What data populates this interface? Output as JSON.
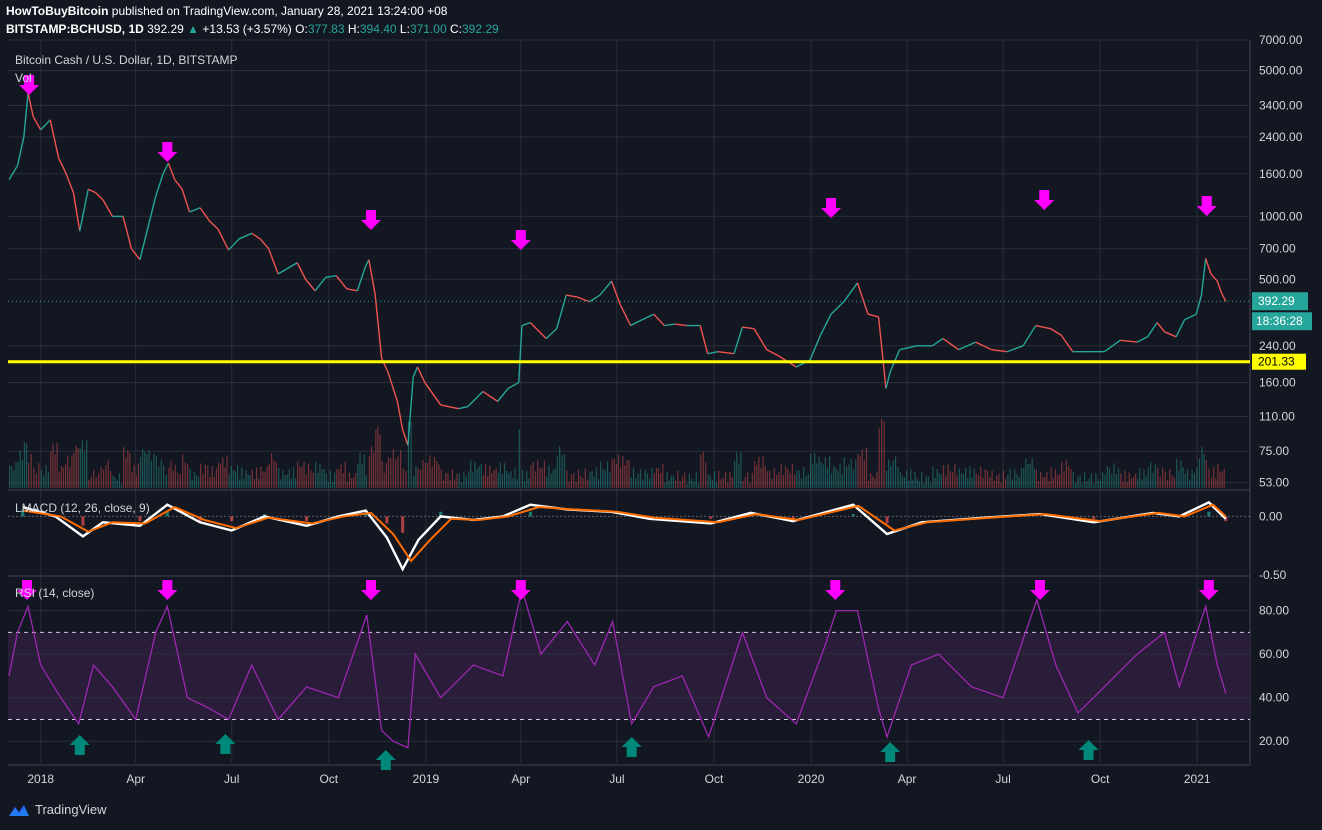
{
  "header": {
    "author": "HowToBuyBitcoin",
    "published": "published on TradingView.com, January 28, 2021 13:24:00 +08",
    "symbol": "BITSTAMP:BCHUSD, 1D",
    "price": "392.29",
    "change_arrow": "▲",
    "change": "+13.53 (+3.57%)",
    "o_label": "O:",
    "o_value": "377.83",
    "h_label": "H:",
    "h_value": "394.40",
    "l_label": "L:",
    "l_value": "371.00",
    "c_label": "C:",
    "c_value": "392.29"
  },
  "legend": {
    "main_title": "Bitcoin Cash / U.S. Dollar, 1D, BITSTAMP",
    "vol": "Vol",
    "lmacd": "LMACD (12, 26, close, 9)",
    "rsi": "RSI (14, close)"
  },
  "footer": {
    "brand": "TradingView",
    "logo_icon": "tradingview-logo-icon"
  },
  "colors": {
    "background": "#131722",
    "grid": "#2a2e39",
    "up": "#26a69a",
    "down": "#ef5350",
    "marker_sell": "#ff00ff",
    "marker_buy": "#00897b",
    "support": "#ffff00",
    "macd": "#ffffff",
    "signal": "#ff6d00",
    "rsi": "#9c27b0",
    "rsi_band": "#2a1d3a"
  },
  "chart_data": [
    {
      "type": "line",
      "name": "price",
      "yscale": "log",
      "ylim": [
        50,
        7000
      ],
      "y_ticks": [
        "7000.00",
        "5000.00",
        "3400.00",
        "2400.00",
        "1600.00",
        "1000.00",
        "700.00",
        "500.00",
        "240.00",
        "160.00",
        "110.00",
        "75.00",
        "53.00"
      ],
      "x_ticks": [
        "2018",
        "Apr",
        "Jul",
        "Oct",
        "2019",
        "Apr",
        "Jul",
        "Oct",
        "2020",
        "Apr",
        "Jul",
        "Oct",
        "2021"
      ],
      "x_range": [
        "2017-12-01",
        "2021-02-20"
      ],
      "points": [
        [
          "2017-12-02",
          1500
        ],
        [
          "2017-12-10",
          1750
        ],
        [
          "2017-12-16",
          2400
        ],
        [
          "2017-12-20",
          3900
        ],
        [
          "2017-12-25",
          3000
        ],
        [
          "2018-01-01",
          2600
        ],
        [
          "2018-01-10",
          2900
        ],
        [
          "2018-01-18",
          1900
        ],
        [
          "2018-01-24",
          1650
        ],
        [
          "2018-02-01",
          1300
        ],
        [
          "2018-02-07",
          850
        ],
        [
          "2018-02-15",
          1350
        ],
        [
          "2018-02-22",
          1300
        ],
        [
          "2018-03-01",
          1200
        ],
        [
          "2018-03-10",
          1000
        ],
        [
          "2018-03-20",
          1000
        ],
        [
          "2018-03-28",
          700
        ],
        [
          "2018-04-05",
          620
        ],
        [
          "2018-04-13",
          900
        ],
        [
          "2018-04-20",
          1250
        ],
        [
          "2018-04-27",
          1600
        ],
        [
          "2018-05-02",
          1800
        ],
        [
          "2018-05-08",
          1500
        ],
        [
          "2018-05-15",
          1350
        ],
        [
          "2018-05-22",
          1050
        ],
        [
          "2018-06-01",
          1100
        ],
        [
          "2018-06-10",
          950
        ],
        [
          "2018-06-18",
          870
        ],
        [
          "2018-06-28",
          690
        ],
        [
          "2018-07-08",
          780
        ],
        [
          "2018-07-20",
          830
        ],
        [
          "2018-07-28",
          780
        ],
        [
          "2018-08-05",
          700
        ],
        [
          "2018-08-14",
          530
        ],
        [
          "2018-08-22",
          560
        ],
        [
          "2018-09-01",
          600
        ],
        [
          "2018-09-09",
          500
        ],
        [
          "2018-09-18",
          440
        ],
        [
          "2018-09-28",
          510
        ],
        [
          "2018-10-08",
          520
        ],
        [
          "2018-10-18",
          450
        ],
        [
          "2018-10-28",
          440
        ],
        [
          "2018-11-05",
          580
        ],
        [
          "2018-11-08",
          620
        ],
        [
          "2018-11-14",
          420
        ],
        [
          "2018-11-20",
          210
        ],
        [
          "2018-11-26",
          180
        ],
        [
          "2018-12-05",
          130
        ],
        [
          "2018-12-10",
          95
        ],
        [
          "2018-12-15",
          80
        ],
        [
          "2018-12-20",
          170
        ],
        [
          "2018-12-24",
          190
        ],
        [
          "2018-12-31",
          160
        ],
        [
          "2019-01-15",
          125
        ],
        [
          "2019-02-01",
          120
        ],
        [
          "2019-02-10",
          123
        ],
        [
          "2019-02-24",
          145
        ],
        [
          "2019-03-10",
          130
        ],
        [
          "2019-03-20",
          150
        ],
        [
          "2019-03-30",
          160
        ],
        [
          "2019-04-02",
          300
        ],
        [
          "2019-04-10",
          310
        ],
        [
          "2019-04-25",
          260
        ],
        [
          "2019-05-05",
          290
        ],
        [
          "2019-05-14",
          420
        ],
        [
          "2019-05-25",
          410
        ],
        [
          "2019-06-05",
          390
        ],
        [
          "2019-06-15",
          420
        ],
        [
          "2019-06-26",
          490
        ],
        [
          "2019-07-04",
          380
        ],
        [
          "2019-07-14",
          300
        ],
        [
          "2019-07-25",
          320
        ],
        [
          "2019-08-05",
          340
        ],
        [
          "2019-08-15",
          300
        ],
        [
          "2019-08-25",
          305
        ],
        [
          "2019-09-05",
          300
        ],
        [
          "2019-09-18",
          300
        ],
        [
          "2019-09-25",
          220
        ],
        [
          "2019-10-05",
          225
        ],
        [
          "2019-10-20",
          220
        ],
        [
          "2019-10-28",
          295
        ],
        [
          "2019-11-08",
          290
        ],
        [
          "2019-11-20",
          230
        ],
        [
          "2019-12-01",
          215
        ],
        [
          "2019-12-18",
          190
        ],
        [
          "2019-12-31",
          205
        ],
        [
          "2020-01-10",
          270
        ],
        [
          "2020-01-20",
          340
        ],
        [
          "2020-02-01",
          390
        ],
        [
          "2020-02-14",
          480
        ],
        [
          "2020-02-24",
          340
        ],
        [
          "2020-03-05",
          330
        ],
        [
          "2020-03-12",
          150
        ],
        [
          "2020-03-16",
          180
        ],
        [
          "2020-03-25",
          230
        ],
        [
          "2020-04-10",
          240
        ],
        [
          "2020-04-25",
          240
        ],
        [
          "2020-05-05",
          260
        ],
        [
          "2020-05-20",
          230
        ],
        [
          "2020-06-05",
          250
        ],
        [
          "2020-06-20",
          230
        ],
        [
          "2020-07-05",
          225
        ],
        [
          "2020-07-20",
          240
        ],
        [
          "2020-08-01",
          300
        ],
        [
          "2020-08-15",
          290
        ],
        [
          "2020-08-25",
          270
        ],
        [
          "2020-09-05",
          225
        ],
        [
          "2020-09-20",
          225
        ],
        [
          "2020-10-05",
          225
        ],
        [
          "2020-10-20",
          255
        ],
        [
          "2020-11-05",
          250
        ],
        [
          "2020-11-15",
          265
        ],
        [
          "2020-11-24",
          310
        ],
        [
          "2020-12-01",
          280
        ],
        [
          "2020-12-12",
          265
        ],
        [
          "2020-12-20",
          320
        ],
        [
          "2020-12-31",
          340
        ],
        [
          "2021-01-05",
          420
        ],
        [
          "2021-01-09",
          630
        ],
        [
          "2021-01-14",
          530
        ],
        [
          "2021-01-20",
          490
        ],
        [
          "2021-01-24",
          430
        ],
        [
          "2021-01-28",
          392.29
        ]
      ],
      "last_price": "392.29",
      "countdown": "18:36:28",
      "support_level": 201.33,
      "support_label": "201.33",
      "sell_markers": [
        "2017-12-21",
        "2018-05-01",
        "2018-11-10",
        "2019-04-01",
        "2020-01-20",
        "2020-08-09",
        "2021-01-10"
      ]
    },
    {
      "type": "line",
      "name": "LMACD",
      "ylim": [
        -0.5,
        0.2
      ],
      "y_ticks": [
        "0.00",
        "-0.50"
      ],
      "points": [
        [
          "2017-12-15",
          0.08
        ],
        [
          "2018-01-15",
          0.0
        ],
        [
          "2018-02-10",
          -0.17
        ],
        [
          "2018-03-01",
          -0.05
        ],
        [
          "2018-04-05",
          -0.08
        ],
        [
          "2018-05-01",
          0.1
        ],
        [
          "2018-06-01",
          -0.05
        ],
        [
          "2018-07-01",
          -0.12
        ],
        [
          "2018-08-01",
          0.0
        ],
        [
          "2018-09-10",
          -0.08
        ],
        [
          "2018-10-10",
          0.0
        ],
        [
          "2018-11-05",
          0.05
        ],
        [
          "2018-11-25",
          -0.18
        ],
        [
          "2018-12-10",
          -0.45
        ],
        [
          "2018-12-25",
          -0.2
        ],
        [
          "2019-01-15",
          0.0
        ],
        [
          "2019-02-15",
          -0.03
        ],
        [
          "2019-03-15",
          0.0
        ],
        [
          "2019-04-10",
          0.1
        ],
        [
          "2019-05-15",
          0.06
        ],
        [
          "2019-06-25",
          0.04
        ],
        [
          "2019-08-01",
          -0.02
        ],
        [
          "2019-09-28",
          -0.06
        ],
        [
          "2019-11-05",
          0.03
        ],
        [
          "2019-12-15",
          -0.04
        ],
        [
          "2020-02-10",
          0.1
        ],
        [
          "2020-03-13",
          -0.15
        ],
        [
          "2020-04-15",
          -0.05
        ],
        [
          "2020-06-15",
          -0.01
        ],
        [
          "2020-08-05",
          0.02
        ],
        [
          "2020-09-25",
          -0.05
        ],
        [
          "2020-11-20",
          0.03
        ],
        [
          "2020-12-15",
          0.0
        ],
        [
          "2021-01-12",
          0.12
        ],
        [
          "2021-01-28",
          -0.02
        ]
      ],
      "signal_points": [
        [
          "2017-12-15",
          0.05
        ],
        [
          "2018-01-20",
          0.0
        ],
        [
          "2018-02-15",
          -0.13
        ],
        [
          "2018-03-10",
          -0.05
        ],
        [
          "2018-04-10",
          -0.06
        ],
        [
          "2018-05-08",
          0.08
        ],
        [
          "2018-06-05",
          -0.03
        ],
        [
          "2018-07-05",
          -0.1
        ],
        [
          "2018-08-05",
          -0.01
        ],
        [
          "2018-09-15",
          -0.06
        ],
        [
          "2018-10-15",
          0.0
        ],
        [
          "2018-11-10",
          0.03
        ],
        [
          "2018-12-01",
          -0.15
        ],
        [
          "2018-12-18",
          -0.38
        ],
        [
          "2019-01-05",
          -0.2
        ],
        [
          "2019-01-25",
          -0.02
        ],
        [
          "2019-02-20",
          -0.03
        ],
        [
          "2019-03-20",
          0.0
        ],
        [
          "2019-04-18",
          0.08
        ],
        [
          "2019-05-20",
          0.06
        ],
        [
          "2019-07-01",
          0.04
        ],
        [
          "2019-08-05",
          -0.01
        ],
        [
          "2019-10-05",
          -0.05
        ],
        [
          "2019-11-10",
          0.02
        ],
        [
          "2019-12-20",
          -0.03
        ],
        [
          "2020-02-15",
          0.09
        ],
        [
          "2020-03-20",
          -0.12
        ],
        [
          "2020-04-20",
          -0.05
        ],
        [
          "2020-06-20",
          -0.01
        ],
        [
          "2020-08-10",
          0.02
        ],
        [
          "2020-10-01",
          -0.04
        ],
        [
          "2020-11-25",
          0.03
        ],
        [
          "2020-12-20",
          0.0
        ],
        [
          "2021-01-16",
          0.1
        ],
        [
          "2021-01-28",
          0.0
        ]
      ]
    },
    {
      "type": "line",
      "name": "RSI",
      "ylim": [
        10,
        95
      ],
      "y_ticks": [
        "80.00",
        "60.00",
        "40.00",
        "20.00"
      ],
      "band": [
        30,
        70
      ],
      "points": [
        [
          "2017-12-02",
          50
        ],
        [
          "2017-12-10",
          70
        ],
        [
          "2017-12-20",
          82
        ],
        [
          "2018-01-01",
          55
        ],
        [
          "2018-01-20",
          40
        ],
        [
          "2018-02-06",
          28
        ],
        [
          "2018-02-20",
          55
        ],
        [
          "2018-03-10",
          45
        ],
        [
          "2018-04-01",
          30
        ],
        [
          "2018-04-20",
          70
        ],
        [
          "2018-05-01",
          82
        ],
        [
          "2018-05-20",
          40
        ],
        [
          "2018-06-10",
          35
        ],
        [
          "2018-06-28",
          30
        ],
        [
          "2018-07-20",
          55
        ],
        [
          "2018-08-14",
          30
        ],
        [
          "2018-09-10",
          45
        ],
        [
          "2018-10-10",
          40
        ],
        [
          "2018-11-06",
          78
        ],
        [
          "2018-11-20",
          25
        ],
        [
          "2018-12-01",
          20
        ],
        [
          "2018-12-15",
          17
        ],
        [
          "2018-12-22",
          60
        ],
        [
          "2019-01-15",
          40
        ],
        [
          "2019-02-15",
          55
        ],
        [
          "2019-03-15",
          50
        ],
        [
          "2019-04-02",
          90
        ],
        [
          "2019-04-20",
          60
        ],
        [
          "2019-05-15",
          75
        ],
        [
          "2019-06-10",
          55
        ],
        [
          "2019-06-27",
          75
        ],
        [
          "2019-07-15",
          28
        ],
        [
          "2019-08-05",
          45
        ],
        [
          "2019-09-01",
          50
        ],
        [
          "2019-09-26",
          22
        ],
        [
          "2019-10-28",
          70
        ],
        [
          "2019-11-20",
          40
        ],
        [
          "2019-12-18",
          28
        ],
        [
          "2020-01-15",
          65
        ],
        [
          "2020-01-25",
          80
        ],
        [
          "2020-02-14",
          80
        ],
        [
          "2020-03-05",
          35
        ],
        [
          "2020-03-13",
          22
        ],
        [
          "2020-04-05",
          55
        ],
        [
          "2020-05-01",
          60
        ],
        [
          "2020-06-01",
          45
        ],
        [
          "2020-07-01",
          40
        ],
        [
          "2020-08-02",
          85
        ],
        [
          "2020-08-20",
          55
        ],
        [
          "2020-09-10",
          33
        ],
        [
          "2020-10-05",
          45
        ],
        [
          "2020-11-05",
          60
        ],
        [
          "2020-12-01",
          70
        ],
        [
          "2020-12-15",
          45
        ],
        [
          "2021-01-09",
          82
        ],
        [
          "2021-01-20",
          55
        ],
        [
          "2021-01-28",
          42
        ]
      ],
      "sell_markers": [
        "2017-12-19",
        "2018-05-01",
        "2018-11-10",
        "2019-04-01",
        "2020-01-24",
        "2020-08-05",
        "2021-01-12"
      ],
      "buy_markers": [
        "2018-02-07",
        "2018-06-25",
        "2018-11-24",
        "2019-07-15",
        "2020-03-16",
        "2020-09-20"
      ]
    }
  ]
}
